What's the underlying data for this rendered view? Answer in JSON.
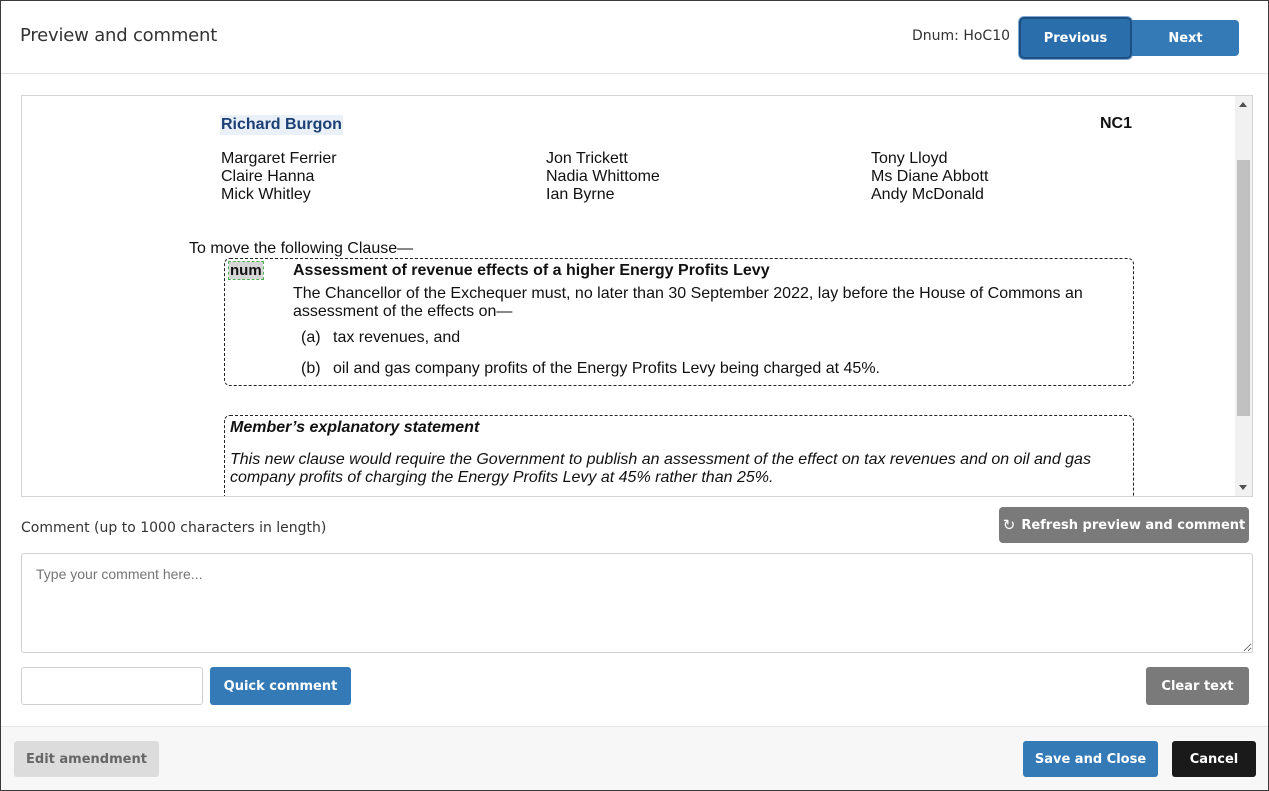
{
  "header": {
    "title": "Preview and comment",
    "dnum": "Dnum: HoC10",
    "previous_label": "Previous",
    "next_label": "Next"
  },
  "preview": {
    "member_in_charge": "Richard Burgon",
    "amendment_number": "NC1",
    "supporters": [
      [
        "Margaret Ferrier",
        "Claire Hanna",
        "Mick Whitley"
      ],
      [
        "Jon Trickett",
        "Nadia Whittome",
        "Ian Byrne"
      ],
      [
        "Tony Lloyd",
        "Ms Diane Abbott",
        "Andy McDonald"
      ]
    ],
    "move_text": "To move the following Clause—",
    "num_placeholder": "num",
    "clause_title": "Assessment of revenue effects of a higher Energy Profits Levy",
    "clause_body": "The Chancellor of the Exchequer must, no later than 30 September 2022, lay before the House of Commons an assessment of the effects on—",
    "paragraphs": [
      {
        "label": "(a)",
        "text": "tax revenues, and"
      },
      {
        "label": "(b)",
        "text": "oil and gas company profits of the Energy Profits Levy being charged at 45%."
      }
    ],
    "explanatory_heading": "Member’s explanatory statement",
    "explanatory_text": "This new clause would require the Government to publish an assessment of the effect on tax revenues and on oil and gas company profits of charging the Energy Profits Levy at 45% rather than 25%."
  },
  "comment": {
    "label": "Comment (up to 1000 characters in length)",
    "refresh_label": "Refresh preview and comment",
    "refresh_icon": "refresh-icon",
    "placeholder": "Type your comment here...",
    "quick_comment_value": "",
    "quick_comment_label": "Quick comment",
    "clear_label": "Clear text"
  },
  "footer": {
    "edit_label": "Edit amendment",
    "save_label": "Save and Close",
    "cancel_label": "Cancel"
  },
  "colors": {
    "primary": "#337ab7",
    "primary_dark": "#2a6eab",
    "secondary": "#7a7a7a",
    "cancel": "#1a1a1a",
    "member_highlight": "#1c3f75"
  }
}
